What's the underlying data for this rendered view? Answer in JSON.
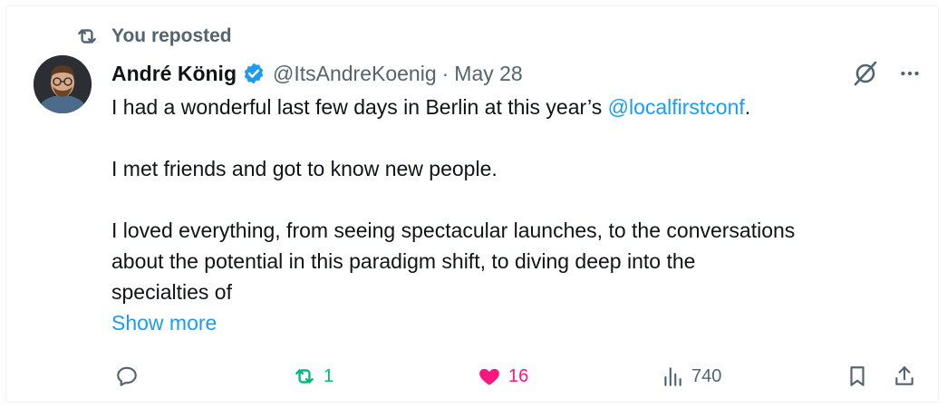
{
  "repost_banner": {
    "text": "You reposted",
    "icon": "repost-icon"
  },
  "author": {
    "name": "André König",
    "handle": "@ItsAndreKoenig",
    "separator": "·",
    "date": "May 28",
    "verified": true
  },
  "tweet": {
    "line1_prefix": "I had a wonderful last few days in Berlin at this year’s ",
    "line1_mention": "@localfirstconf",
    "line1_suffix": ".",
    "paragraph2": "I met friends and got to know new people.",
    "paragraph3_line1": "I loved everything, from seeing spectacular launches, to the conversations",
    "paragraph3_line2": "about the potential in this paradigm shift, to diving deep into the",
    "paragraph3_line3": "specialties of",
    "show_more": "Show more"
  },
  "actions": {
    "reply_count": "",
    "repost_count": "1",
    "like_count": "16",
    "views_count": "740"
  },
  "colors": {
    "accent": "#1d9bf0",
    "repost_active": "#00ba7c",
    "like_active": "#f91880",
    "muted": "#536471",
    "text": "#0f1419"
  }
}
